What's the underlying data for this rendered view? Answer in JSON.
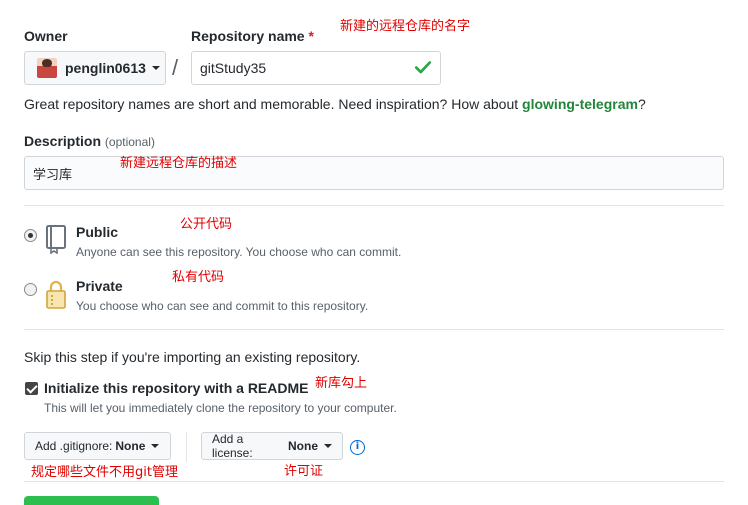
{
  "owner": {
    "label": "Owner",
    "name": "penglin0613"
  },
  "repo": {
    "label": "Repository name",
    "required_mark": "*",
    "value": "gitStudy35"
  },
  "separator": "/",
  "hint": {
    "prefix": "Great repository names are short and memorable. Need inspiration? How about ",
    "suggestion": "glowing-telegram",
    "suffix": "?"
  },
  "description": {
    "label": "Description",
    "optional": "(optional)",
    "value": "学习库"
  },
  "visibility": {
    "public": {
      "title": "Public",
      "subtitle": "Anyone can see this repository. You choose who can commit.",
      "selected": true
    },
    "private": {
      "title": "Private",
      "subtitle": "You choose who can see and commit to this repository.",
      "selected": false
    }
  },
  "skip_note": "Skip this step if you're importing an existing repository.",
  "readme": {
    "title": "Initialize this repository with a README",
    "subtitle": "This will let you immediately clone the repository to your computer.",
    "checked": true
  },
  "gitignore": {
    "prefix": "Add .gitignore:",
    "value": "None"
  },
  "license": {
    "prefix": "Add a license:",
    "value": "None"
  },
  "annotations": {
    "repo_name": "新建的远程仓库的名字",
    "description": "新建远程仓库的描述",
    "public": "公开代码",
    "private": "私有代码",
    "readme": "新库勾上",
    "gitignore": "规定哪些文件不用git管理",
    "license": "许可证"
  },
  "colors": {
    "accent_green": "#2cbe4e",
    "annotation_red": "#e00000",
    "link_blue": "#0366d6",
    "suggestion_green": "#22863a"
  }
}
